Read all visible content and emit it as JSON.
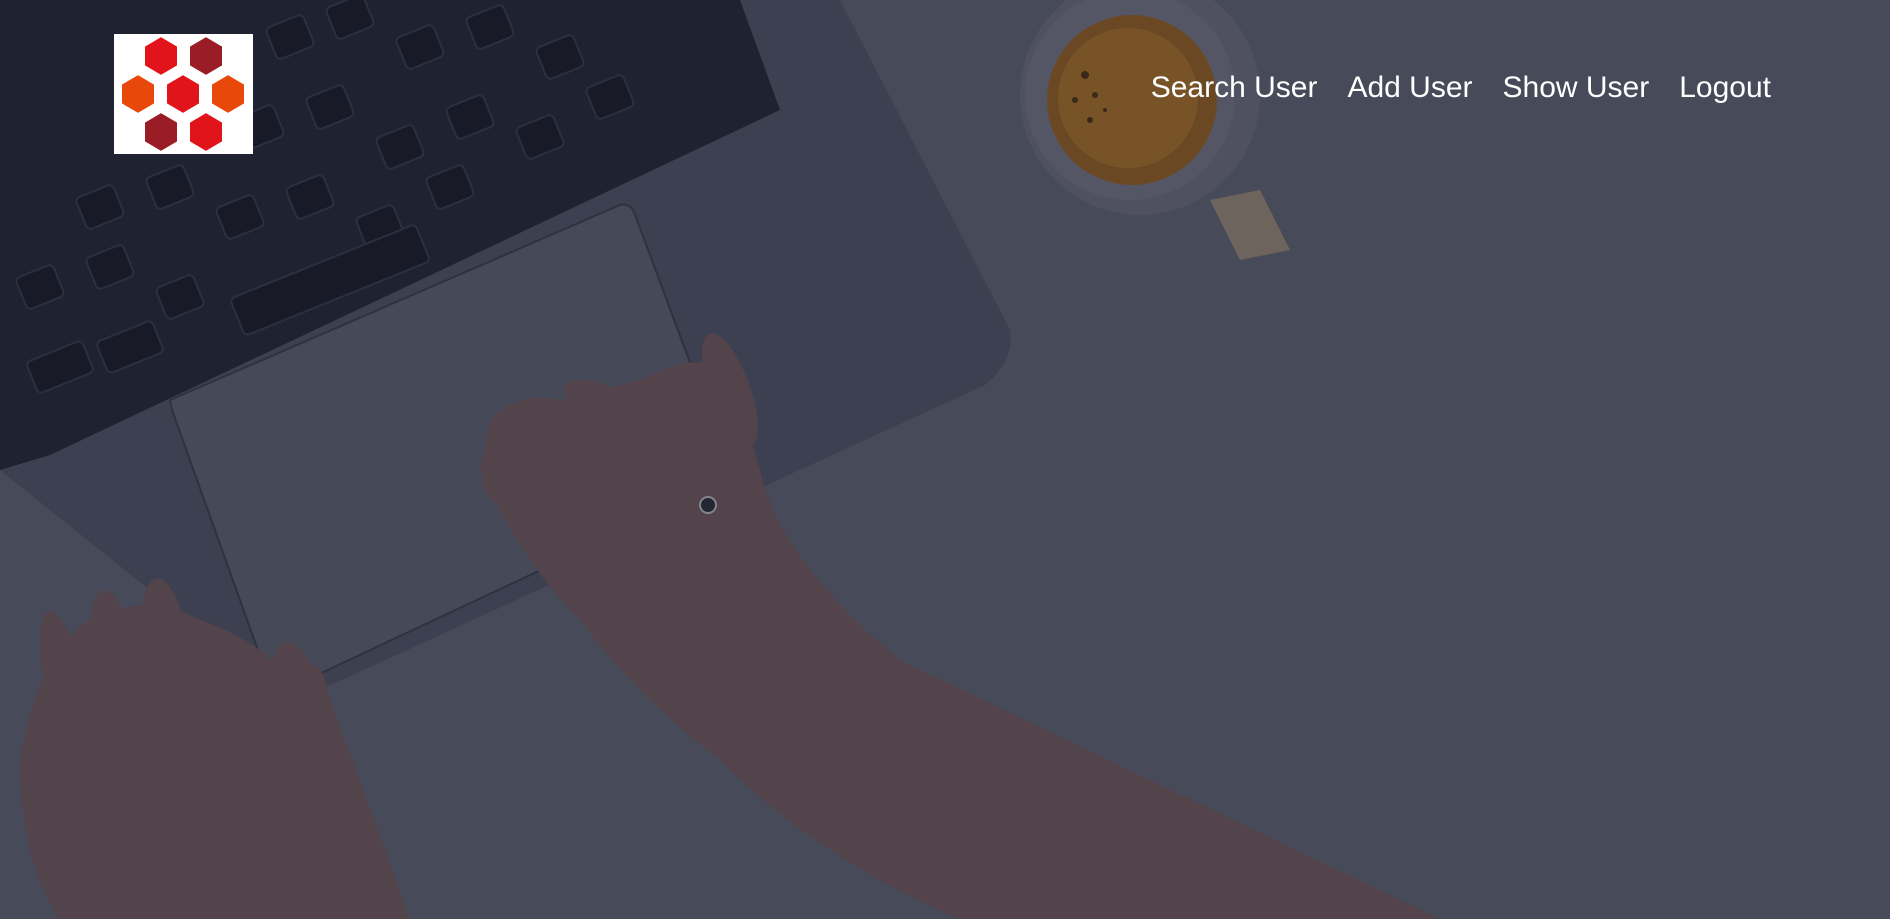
{
  "header": {
    "logo": {
      "name": "hexagon-logo",
      "colors": [
        "#e0141a",
        "#9a1c24",
        "#e8480a"
      ]
    },
    "nav": [
      {
        "label": "Search User"
      },
      {
        "label": "Add User"
      },
      {
        "label": "Show User"
      },
      {
        "label": "Logout"
      }
    ]
  },
  "background": {
    "description_icon": "desk-photo-laptop-hands-coffee",
    "overlay_color": "#4b4d5b"
  }
}
